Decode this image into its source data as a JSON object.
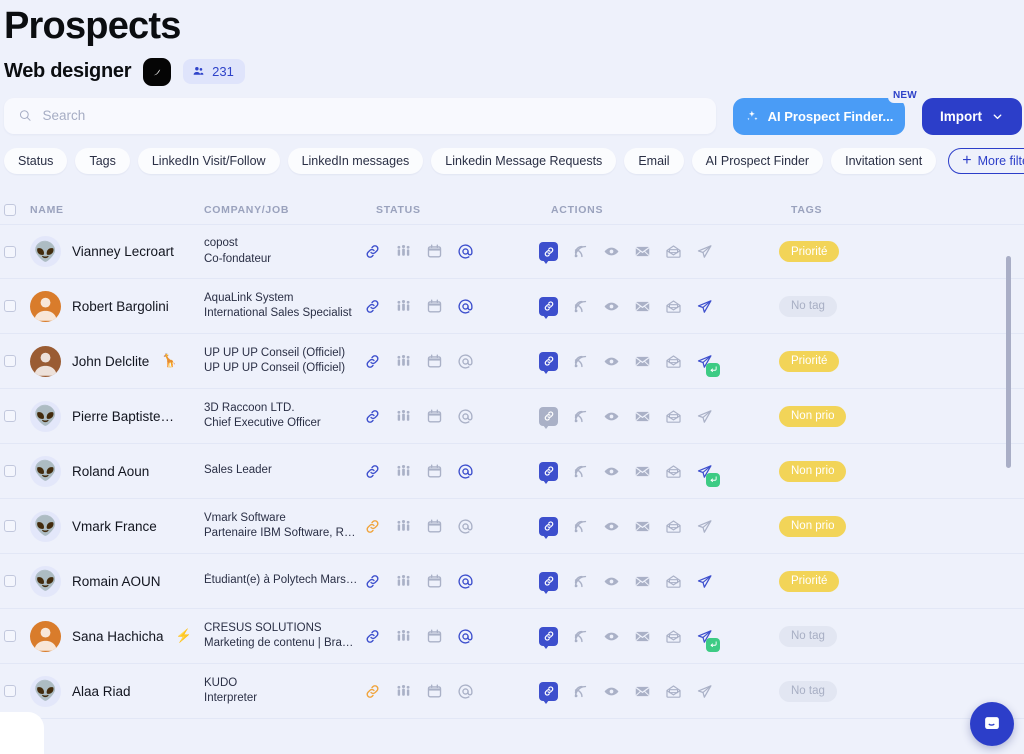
{
  "header": {
    "title": "Prospects",
    "campaign_name": "Web designer",
    "edit_icon": "pen-icon",
    "count_icon": "people-icon",
    "count": "231"
  },
  "search": {
    "placeholder": "Search",
    "value": "",
    "icon": "search-icon"
  },
  "toolbar": {
    "ai_button_label": "AI Prospect Finder...",
    "ai_button_icon": "sparkles-icon",
    "ai_button_badge": "NEW",
    "import_label": "Import",
    "import_icon": "chevron-down-icon",
    "accent_blue": "#2c3ec9",
    "ai_blue": "#4a9cf6"
  },
  "filters": {
    "pills": [
      "Status",
      "Tags",
      "LinkedIn Visit/Follow",
      "LinkedIn messages",
      "Linkedin Message Requests",
      "Email",
      "AI Prospect Finder",
      "Invitation sent"
    ],
    "more_label": "More filters",
    "more_icon": "plus-icon"
  },
  "table": {
    "columns": [
      "NAME",
      "COMPANY/JOB",
      "STATUS",
      "ACTIONS",
      "TAGS"
    ],
    "status_icons": [
      "link-icon",
      "people-icon",
      "calendar-icon",
      "at-icon"
    ],
    "action_icons": [
      "linkedin-link-badge-icon",
      "rss-icon",
      "eye-icon",
      "mail-closed-icon",
      "mail-open-icon",
      "paper-plane-icon"
    ],
    "rows": [
      {
        "name": "Vianney Lecroart",
        "name_emoji": "",
        "avatar": "alien",
        "company": "copost",
        "job": "Co-fondateur",
        "status": {
          "link": "blue",
          "people": "grey",
          "calendar": "grey",
          "at": "blue"
        },
        "actions": {
          "link_badge": "on",
          "rss": "grey",
          "eye": "grey",
          "mail_closed": "grey",
          "mail_open": "grey",
          "plane": "grey",
          "reply_badge": false
        },
        "tag": "Priorité",
        "tag_style": "yellow"
      },
      {
        "name": "Robert Bargolini",
        "name_emoji": "",
        "avatar": "photo",
        "company": "AquaLink System",
        "job": "International Sales Specialist",
        "status": {
          "link": "blue",
          "people": "grey",
          "calendar": "grey",
          "at": "blue"
        },
        "actions": {
          "link_badge": "on",
          "rss": "grey",
          "eye": "grey",
          "mail_closed": "grey",
          "mail_open": "grey",
          "plane": "blue",
          "reply_badge": false
        },
        "tag": "No tag",
        "tag_style": "none"
      },
      {
        "name": "John Delclite",
        "name_emoji": "🦒",
        "avatar": "photo",
        "company": "UP UP UP Conseil (Officiel)",
        "job": "UP UP UP Conseil (Officiel)",
        "status": {
          "link": "blue",
          "people": "grey",
          "calendar": "grey",
          "at": "grey"
        },
        "actions": {
          "link_badge": "on",
          "rss": "grey",
          "eye": "grey",
          "mail_closed": "grey",
          "mail_open": "grey",
          "plane": "blue",
          "reply_badge": true
        },
        "tag": "Priorité",
        "tag_style": "yellow"
      },
      {
        "name": "Pierre Baptiste…",
        "name_emoji": "",
        "avatar": "alien",
        "company": "3D Raccoon LTD.",
        "job": "Chief Executive Officer",
        "status": {
          "link": "blue",
          "people": "grey",
          "calendar": "grey",
          "at": "grey"
        },
        "actions": {
          "link_badge": "off",
          "rss": "grey",
          "eye": "grey",
          "mail_closed": "grey",
          "mail_open": "grey",
          "plane": "grey",
          "reply_badge": false
        },
        "tag": "Non prio",
        "tag_style": "yellow"
      },
      {
        "name": "Roland Aoun",
        "name_emoji": "",
        "avatar": "alien",
        "company": "",
        "job": "Sales Leader",
        "status": {
          "link": "blue",
          "people": "grey",
          "calendar": "grey",
          "at": "blue"
        },
        "actions": {
          "link_badge": "on",
          "rss": "grey",
          "eye": "grey",
          "mail_closed": "grey",
          "mail_open": "grey",
          "plane": "blue",
          "reply_badge": true
        },
        "tag": "Non prio",
        "tag_style": "yellow"
      },
      {
        "name": "Vmark France",
        "name_emoji": "",
        "avatar": "alien",
        "company": "Vmark Software",
        "job": "Partenaire IBM Software, R…",
        "status": {
          "link": "orange",
          "people": "grey",
          "calendar": "grey",
          "at": "grey"
        },
        "actions": {
          "link_badge": "on",
          "rss": "grey",
          "eye": "grey",
          "mail_closed": "grey",
          "mail_open": "grey",
          "plane": "grey",
          "reply_badge": false
        },
        "tag": "Non prio",
        "tag_style": "yellow"
      },
      {
        "name": "Romain AOUN",
        "name_emoji": "",
        "avatar": "alien",
        "company": "",
        "job": "Étudiant(e) à Polytech Mars…",
        "status": {
          "link": "blue",
          "people": "grey",
          "calendar": "grey",
          "at": "blue"
        },
        "actions": {
          "link_badge": "on",
          "rss": "grey",
          "eye": "grey",
          "mail_closed": "grey",
          "mail_open": "grey",
          "plane": "blue",
          "reply_badge": false
        },
        "tag": "Priorité",
        "tag_style": "yellow"
      },
      {
        "name": "Sana Hachicha",
        "name_emoji": "⚡",
        "avatar": "photo",
        "company": "CRESUS SOLUTIONS",
        "job": "Marketing de contenu | Bra…",
        "status": {
          "link": "blue",
          "people": "grey",
          "calendar": "grey",
          "at": "blue"
        },
        "actions": {
          "link_badge": "on",
          "rss": "grey",
          "eye": "grey",
          "mail_closed": "grey",
          "mail_open": "grey",
          "plane": "blue",
          "reply_badge": true
        },
        "tag": "No tag",
        "tag_style": "none"
      },
      {
        "name": "Alaa Riad",
        "name_emoji": "",
        "avatar": "alien",
        "company": "KUDO",
        "job": "Interpreter",
        "status": {
          "link": "orange",
          "people": "grey",
          "calendar": "grey",
          "at": "grey"
        },
        "actions": {
          "link_badge": "on",
          "rss": "grey",
          "eye": "grey",
          "mail_closed": "grey",
          "mail_open": "grey",
          "plane": "grey",
          "reply_badge": false
        },
        "tag": "No tag",
        "tag_style": "none"
      }
    ]
  },
  "chat": {
    "icon": "chat-bubble-icon"
  },
  "colors": {
    "background": "#eef1fb",
    "blue": "#3d4fcd",
    "orange": "#f0a43c",
    "grey": "#aab1c7",
    "tag_yellow": "#f2d458"
  }
}
